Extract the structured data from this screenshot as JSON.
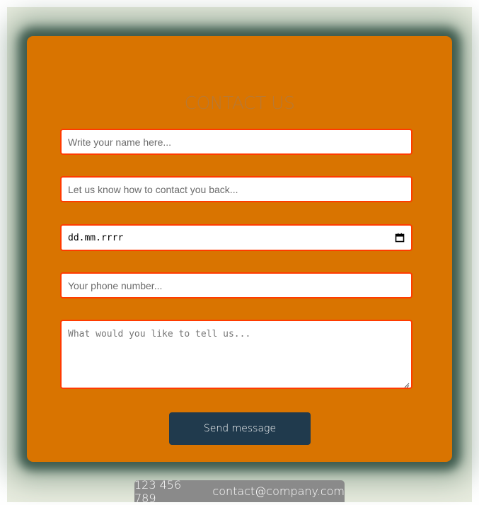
{
  "form": {
    "title": "CONTACT US",
    "name_placeholder": "Write your name here...",
    "contact_placeholder": "Let us know how to contact you back...",
    "date_placeholder": "dd.mm.rrrr",
    "phone_placeholder": "Your phone number...",
    "message_placeholder": "What would you like to tell us...",
    "send_label": "Send message"
  },
  "footer": {
    "phone": "123 456 789",
    "email": "contact@company.com"
  },
  "colors": {
    "card": "#d97400",
    "field_border": "#ff3b00",
    "button": "#203a4d",
    "footer": "#8a8a8a"
  },
  "icons": [
    "calendar-icon",
    "resize-handle-icon"
  ]
}
